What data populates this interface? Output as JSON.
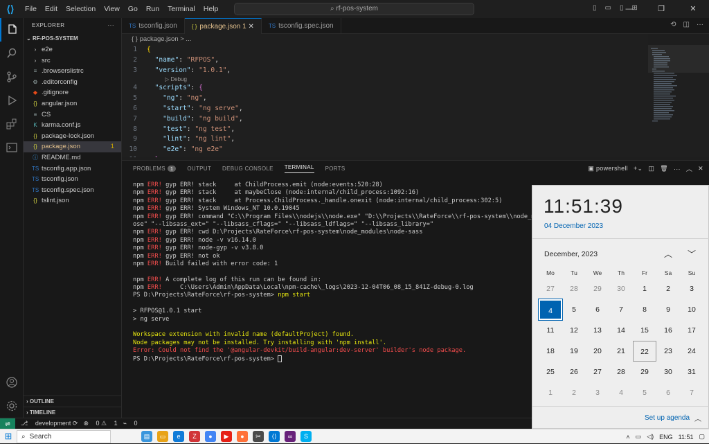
{
  "menu": [
    "File",
    "Edit",
    "Selection",
    "View",
    "Go",
    "Run",
    "Terminal",
    "Help"
  ],
  "command_center": "rf-pos-system",
  "explorer": {
    "title": "EXPLORER",
    "root": "RF-POS-SYSTEM",
    "items": [
      {
        "label": "e2e",
        "icon": "chevron-right",
        "type": "folder"
      },
      {
        "label": "src",
        "icon": "chevron-right",
        "type": "folder"
      },
      {
        "label": ".browserslistrc",
        "icon": "list"
      },
      {
        "label": ".editorconfig",
        "icon": "gear"
      },
      {
        "label": ".gitignore",
        "icon": "git"
      },
      {
        "label": "angular.json",
        "icon": "json"
      },
      {
        "label": "CS",
        "icon": "list"
      },
      {
        "label": "karma.conf.js",
        "icon": "karma"
      },
      {
        "label": "package-lock.json",
        "icon": "json"
      },
      {
        "label": "package.json",
        "icon": "json",
        "badge": "1",
        "selected": true
      },
      {
        "label": "README.md",
        "icon": "info"
      },
      {
        "label": "tsconfig.app.json",
        "icon": "ts"
      },
      {
        "label": "tsconfig.json",
        "icon": "ts"
      },
      {
        "label": "tsconfig.spec.json",
        "icon": "ts"
      },
      {
        "label": "tslint.json",
        "icon": "json"
      }
    ],
    "outline": "OUTLINE",
    "timeline": "TIMELINE"
  },
  "tabs": [
    {
      "label": "tsconfig.json",
      "icon": "TS"
    },
    {
      "label": "package.json 1",
      "icon": "{ }",
      "active": true
    },
    {
      "label": "tsconfig.spec.json",
      "icon": "TS"
    }
  ],
  "breadcrumb": "{ } package.json > ...",
  "code_lens": "▷ Debug",
  "code_lines": [
    {
      "n": "1",
      "html": [
        [
          "p",
          "{"
        ]
      ]
    },
    {
      "n": "2",
      "html": [
        [
          "cd",
          "  "
        ],
        [
          "k",
          "\"name\""
        ],
        [
          "cd",
          ": "
        ],
        [
          "s",
          "\"RFPOS\""
        ],
        [
          "cd",
          ","
        ]
      ]
    },
    {
      "n": "3",
      "html": [
        [
          "cd",
          "  "
        ],
        [
          "k",
          "\"version\""
        ],
        [
          "cd",
          ": "
        ],
        [
          "s",
          "\"1.0.1\""
        ],
        [
          "cd",
          ","
        ]
      ]
    },
    {
      "n": "4",
      "html": [
        [
          "cd",
          "  "
        ],
        [
          "k",
          "\"scripts\""
        ],
        [
          "cd",
          ": "
        ],
        [
          "b2",
          "{"
        ]
      ]
    },
    {
      "n": "5",
      "html": [
        [
          "cd",
          "    "
        ],
        [
          "k",
          "\"ng\""
        ],
        [
          "cd",
          ": "
        ],
        [
          "s",
          "\"ng\""
        ],
        [
          "cd",
          ","
        ]
      ]
    },
    {
      "n": "6",
      "html": [
        [
          "cd",
          "    "
        ],
        [
          "k",
          "\"start\""
        ],
        [
          "cd",
          ": "
        ],
        [
          "s",
          "\"ng serve\""
        ],
        [
          "cd",
          ","
        ]
      ]
    },
    {
      "n": "7",
      "html": [
        [
          "cd",
          "    "
        ],
        [
          "k",
          "\"build\""
        ],
        [
          "cd",
          ": "
        ],
        [
          "s",
          "\"ng build\""
        ],
        [
          "cd",
          ","
        ]
      ]
    },
    {
      "n": "8",
      "html": [
        [
          "cd",
          "    "
        ],
        [
          "k",
          "\"test\""
        ],
        [
          "cd",
          ": "
        ],
        [
          "s",
          "\"ng test\""
        ],
        [
          "cd",
          ","
        ]
      ]
    },
    {
      "n": "9",
      "html": [
        [
          "cd",
          "    "
        ],
        [
          "k",
          "\"lint\""
        ],
        [
          "cd",
          ": "
        ],
        [
          "s",
          "\"ng lint\""
        ],
        [
          "cd",
          ","
        ]
      ]
    },
    {
      "n": "10",
      "html": [
        [
          "cd",
          "    "
        ],
        [
          "k",
          "\"e2e\""
        ],
        [
          "cd",
          ": "
        ],
        [
          "s",
          "\"ng e2e\""
        ]
      ]
    },
    {
      "n": "11",
      "html": [
        [
          "cd",
          "  "
        ],
        [
          "b2",
          "}"
        ],
        [
          "cd",
          ","
        ]
      ]
    }
  ],
  "panel": {
    "tabs": [
      "PROBLEMS",
      "OUTPUT",
      "DEBUG CONSOLE",
      "TERMINAL",
      "PORTS"
    ],
    "problems_count": "1",
    "shell": "powershell"
  },
  "terminal_lines": [
    {
      "c": "npm-err",
      "t": "gyp ERR! stack     at ChildProcess.emit (node:events:520:28)"
    },
    {
      "c": "npm-err",
      "t": "gyp ERR! stack     at maybeClose (node:internal/child_process:1092:16)"
    },
    {
      "c": "npm-err",
      "t": "gyp ERR! stack     at Process.ChildProcess._handle.onexit (node:internal/child_process:302:5)"
    },
    {
      "c": "npm-err",
      "t": "gyp ERR! System Windows_NT 10.0.19045"
    },
    {
      "c": "npm-err",
      "t": "gyp ERR! command \"C:\\\\Program Files\\\\nodejs\\\\node.exe\" \"D:\\\\Projects\\\\RateForce\\\\rf-pos-system\\\\node_module"
    },
    {
      "c": "plain",
      "t": "ose\" \"--libsass_ext=\" \"--libsass_cflags=\" \"--libsass_ldflags=\" \"--libsass_library=\""
    },
    {
      "c": "npm-err",
      "t": "gyp ERR! cwd D:\\Projects\\RateForce\\rf-pos-system\\node_modules\\node-sass"
    },
    {
      "c": "npm-err",
      "t": "gyp ERR! node -v v16.14.0"
    },
    {
      "c": "npm-err",
      "t": "gyp ERR! node-gyp -v v3.8.0"
    },
    {
      "c": "npm-err",
      "t": "gyp ERR! not ok"
    },
    {
      "c": "npm-err",
      "t": "Build failed with error code: 1"
    },
    {
      "c": "plain",
      "t": ""
    },
    {
      "c": "npm-err",
      "t": "A complete log of this run can be found in:"
    },
    {
      "c": "npm-err",
      "t": "    C:\\Users\\Admin\\AppData\\Local\\npm-cache\\_logs\\2023-12-04T06_08_15_841Z-debug-0.log"
    },
    {
      "c": "prompt-red",
      "t": "PS D:\\Projects\\RateForce\\rf-pos-system> ",
      "cmd": "npm start"
    },
    {
      "c": "plain",
      "t": ""
    },
    {
      "c": "plain",
      "t": "> RFPOS@1.0.1 start"
    },
    {
      "c": "plain",
      "t": "> ng serve"
    },
    {
      "c": "plain",
      "t": ""
    },
    {
      "c": "yellow",
      "t": "Workspace extension with invalid name (defaultProject) found."
    },
    {
      "c": "yellow",
      "t": "Node packages may not be installed. Try installing with 'npm install'."
    },
    {
      "c": "red",
      "t": "Error: Could not find the '@angular-devkit/build-angular:dev-server' builder's node package."
    },
    {
      "c": "prompt-gray",
      "t": "PS D:\\Projects\\RateForce\\rf-pos-system> ",
      "cursor": true
    }
  ],
  "status": {
    "branch": "development",
    "errors": "0",
    "warnings": "1",
    "ports": "0"
  },
  "taskbar": {
    "search": "Search",
    "lang": "ENG",
    "time": "11:51"
  },
  "calendar": {
    "time": "11:51:39",
    "date": "04 December 2023",
    "month": "December, 2023",
    "weekdays": [
      "Mo",
      "Tu",
      "We",
      "Th",
      "Fr",
      "Sa",
      "Su"
    ],
    "weeks": [
      [
        [
          "27",
          "o"
        ],
        [
          "28",
          "o"
        ],
        [
          "29",
          "o"
        ],
        [
          "30",
          "o"
        ],
        [
          "1",
          ""
        ],
        [
          "2",
          ""
        ],
        [
          "3",
          ""
        ]
      ],
      [
        [
          "4",
          "today"
        ],
        [
          "5",
          ""
        ],
        [
          "6",
          ""
        ],
        [
          "7",
          ""
        ],
        [
          "8",
          ""
        ],
        [
          "9",
          ""
        ],
        [
          "10",
          ""
        ]
      ],
      [
        [
          "11",
          ""
        ],
        [
          "12",
          ""
        ],
        [
          "13",
          ""
        ],
        [
          "14",
          ""
        ],
        [
          "15",
          ""
        ],
        [
          "16",
          ""
        ],
        [
          "17",
          ""
        ]
      ],
      [
        [
          "18",
          ""
        ],
        [
          "19",
          ""
        ],
        [
          "20",
          ""
        ],
        [
          "21",
          ""
        ],
        [
          "22",
          "hov"
        ],
        [
          "23",
          ""
        ],
        [
          "24",
          ""
        ]
      ],
      [
        [
          "25",
          ""
        ],
        [
          "26",
          ""
        ],
        [
          "27",
          ""
        ],
        [
          "28",
          ""
        ],
        [
          "29",
          ""
        ],
        [
          "30",
          ""
        ],
        [
          "31",
          ""
        ]
      ],
      [
        [
          "1",
          "o"
        ],
        [
          "2",
          "o"
        ],
        [
          "3",
          "o"
        ],
        [
          "4",
          "o"
        ],
        [
          "5",
          "o"
        ],
        [
          "6",
          "o"
        ],
        [
          "7",
          "o"
        ]
      ]
    ],
    "agenda": "Set up agenda"
  }
}
